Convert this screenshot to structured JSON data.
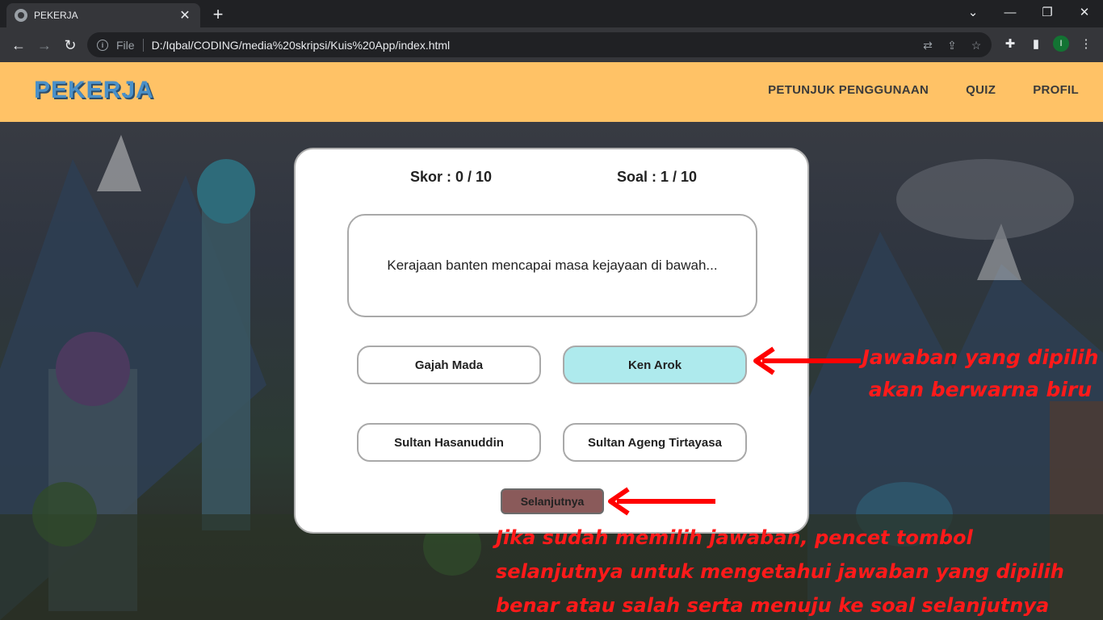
{
  "browser": {
    "tab_title": "PEKERJA",
    "file_label": "File",
    "url": "D:/Iqbal/CODING/media%20skripsi/Kuis%20App/index.html",
    "profile_initial": "I"
  },
  "navbar": {
    "logo": "PEKERJA",
    "menu": [
      "PETUNJUK PENGGUNAAN",
      "QUIZ",
      "PROFIL"
    ]
  },
  "quiz": {
    "score_text": "Skor : 0 / 10",
    "question_number_text": "Soal : 1 / 10",
    "question": "Kerajaan banten mencapai masa kejayaan di bawah...",
    "options": [
      "Gajah Mada",
      "Ken Arok",
      "Sultan Hasanuddin",
      "Sultan Ageng Tirtayasa"
    ],
    "selected_option": "Ken Arok",
    "next_label": "Selanjutnya"
  },
  "annotations": {
    "selected_note": "Jawaban yang dipilih akan berwarna biru",
    "next_note": "Jika sudah memilih jawaban, pencet tombol selanjutnya untuk mengetahui jawaban yang dipilih benar atau salah serta menuju ke soal selanjutnya"
  },
  "colors": {
    "navbar": "#ffc266",
    "logo": "#4a90c8",
    "selected_option": "#aeeaed",
    "next_button": "#8a5a5a",
    "annotation": "#ff1a1a"
  }
}
